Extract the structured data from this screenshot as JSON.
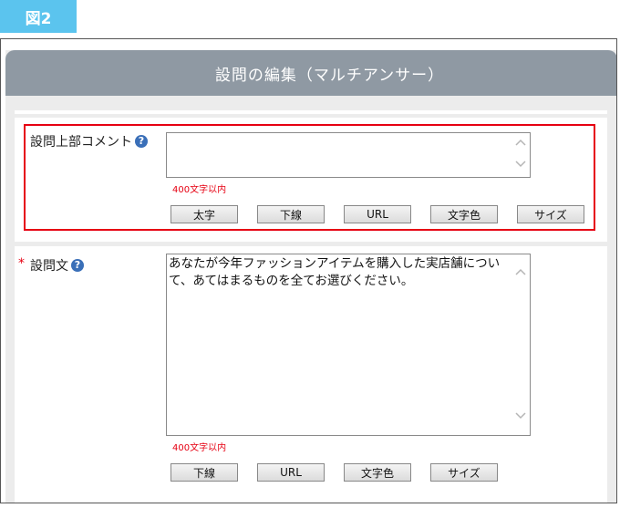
{
  "figure_label": "図2",
  "header": {
    "title": "設問の編集（マルチアンサー）"
  },
  "top_comment": {
    "label": "設問上部コメント",
    "help_icon": "question-circle-icon",
    "value": "",
    "limit_note": "400文字以内",
    "buttons": [
      "太字",
      "下線",
      "URL",
      "文字色",
      "サイズ"
    ]
  },
  "question_text": {
    "required_mark": "*",
    "label": "設問文",
    "help_icon": "question-circle-icon",
    "value": "あなたが今年ファッションアイテムを購入した実店舗について、あてはまるものを全てお選びください。",
    "limit_note": "400文字以内",
    "buttons": [
      "下線",
      "URL",
      "文字色",
      "サイズ"
    ]
  },
  "colors": {
    "badge": "#5bc4ee",
    "header": "#8f99a3",
    "highlight": "#e60012",
    "help_icon": "#3a6fb8"
  }
}
